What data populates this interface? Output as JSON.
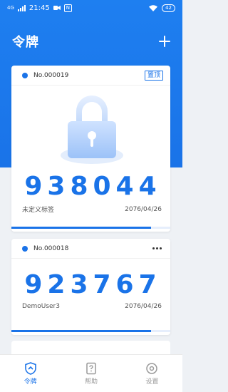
{
  "status_bar": {
    "network": "4G",
    "time": "21:45",
    "battery": "42"
  },
  "header": {
    "title": "令牌"
  },
  "tokens": [
    {
      "number": "No.000019",
      "code": "938044",
      "label": "未定义标签",
      "date": "2076/04/26",
      "action_label": "置顶",
      "progress": 0.88
    },
    {
      "number": "No.000018",
      "code": "923767",
      "label": "DemoUser3",
      "date": "2076/04/26",
      "progress": 0.88
    }
  ],
  "tabbar": {
    "items": [
      {
        "label": "令牌",
        "icon": "shield-icon",
        "active": true
      },
      {
        "label": "帮助",
        "icon": "help-book-icon",
        "active": false
      },
      {
        "label": "设置",
        "icon": "settings-icon",
        "active": false
      }
    ]
  },
  "colors": {
    "accent": "#1a73e8",
    "background": "#eef1f5",
    "card": "#ffffff"
  }
}
